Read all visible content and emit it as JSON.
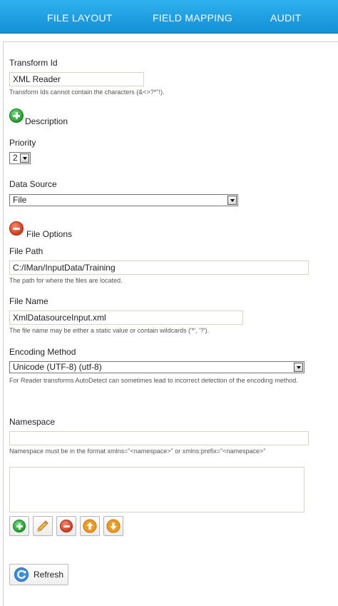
{
  "tabs": {
    "file_layout": "FILE LAYOUT",
    "field_mapping": "FIELD MAPPING",
    "audit": "AUDIT"
  },
  "form": {
    "transform_id": {
      "label": "Transform Id",
      "value": "XML Reader",
      "hint": "Transform Ids cannot contain the characters (&<>?*\"!)."
    },
    "description": {
      "label": "Description",
      "icon": "add-icon"
    },
    "priority": {
      "label": "Priority",
      "value": "2"
    },
    "data_source": {
      "label": "Data Source",
      "value": "File"
    },
    "file_options": {
      "label": "File Options",
      "icon": "collapse-icon"
    },
    "file_path": {
      "label": "File Path",
      "value": "C:/IMan/InputData/Training",
      "hint": "The path for where the files are located."
    },
    "file_name": {
      "label": "File Name",
      "value": "XmlDatasourceInput.xml",
      "hint": "The file name may be either a static value or contain wildcards ('*', '?')."
    },
    "encoding": {
      "label": "Encoding Method",
      "value": "Unicode (UTF-8) (utf-8)",
      "hint": "For Reader transforms AutoDetect can sometimes lead to incorrect detection of the encoding method."
    },
    "namespace": {
      "label": "Namespace",
      "value": "",
      "hint": "Namespace must be in the format xmlns=\"<namespace>\" or xmlns:prefix=\"<namespace>\""
    }
  },
  "toolbar": {
    "icons": [
      "add-icon",
      "edit-pencil-icon",
      "remove-icon",
      "move-up-icon",
      "move-down-icon"
    ]
  },
  "refresh": {
    "label": "Refresh"
  },
  "colors": {
    "header": "#1a9ee2",
    "green": "#1fa02e",
    "red": "#d9361a",
    "orange": "#f29a1c"
  }
}
